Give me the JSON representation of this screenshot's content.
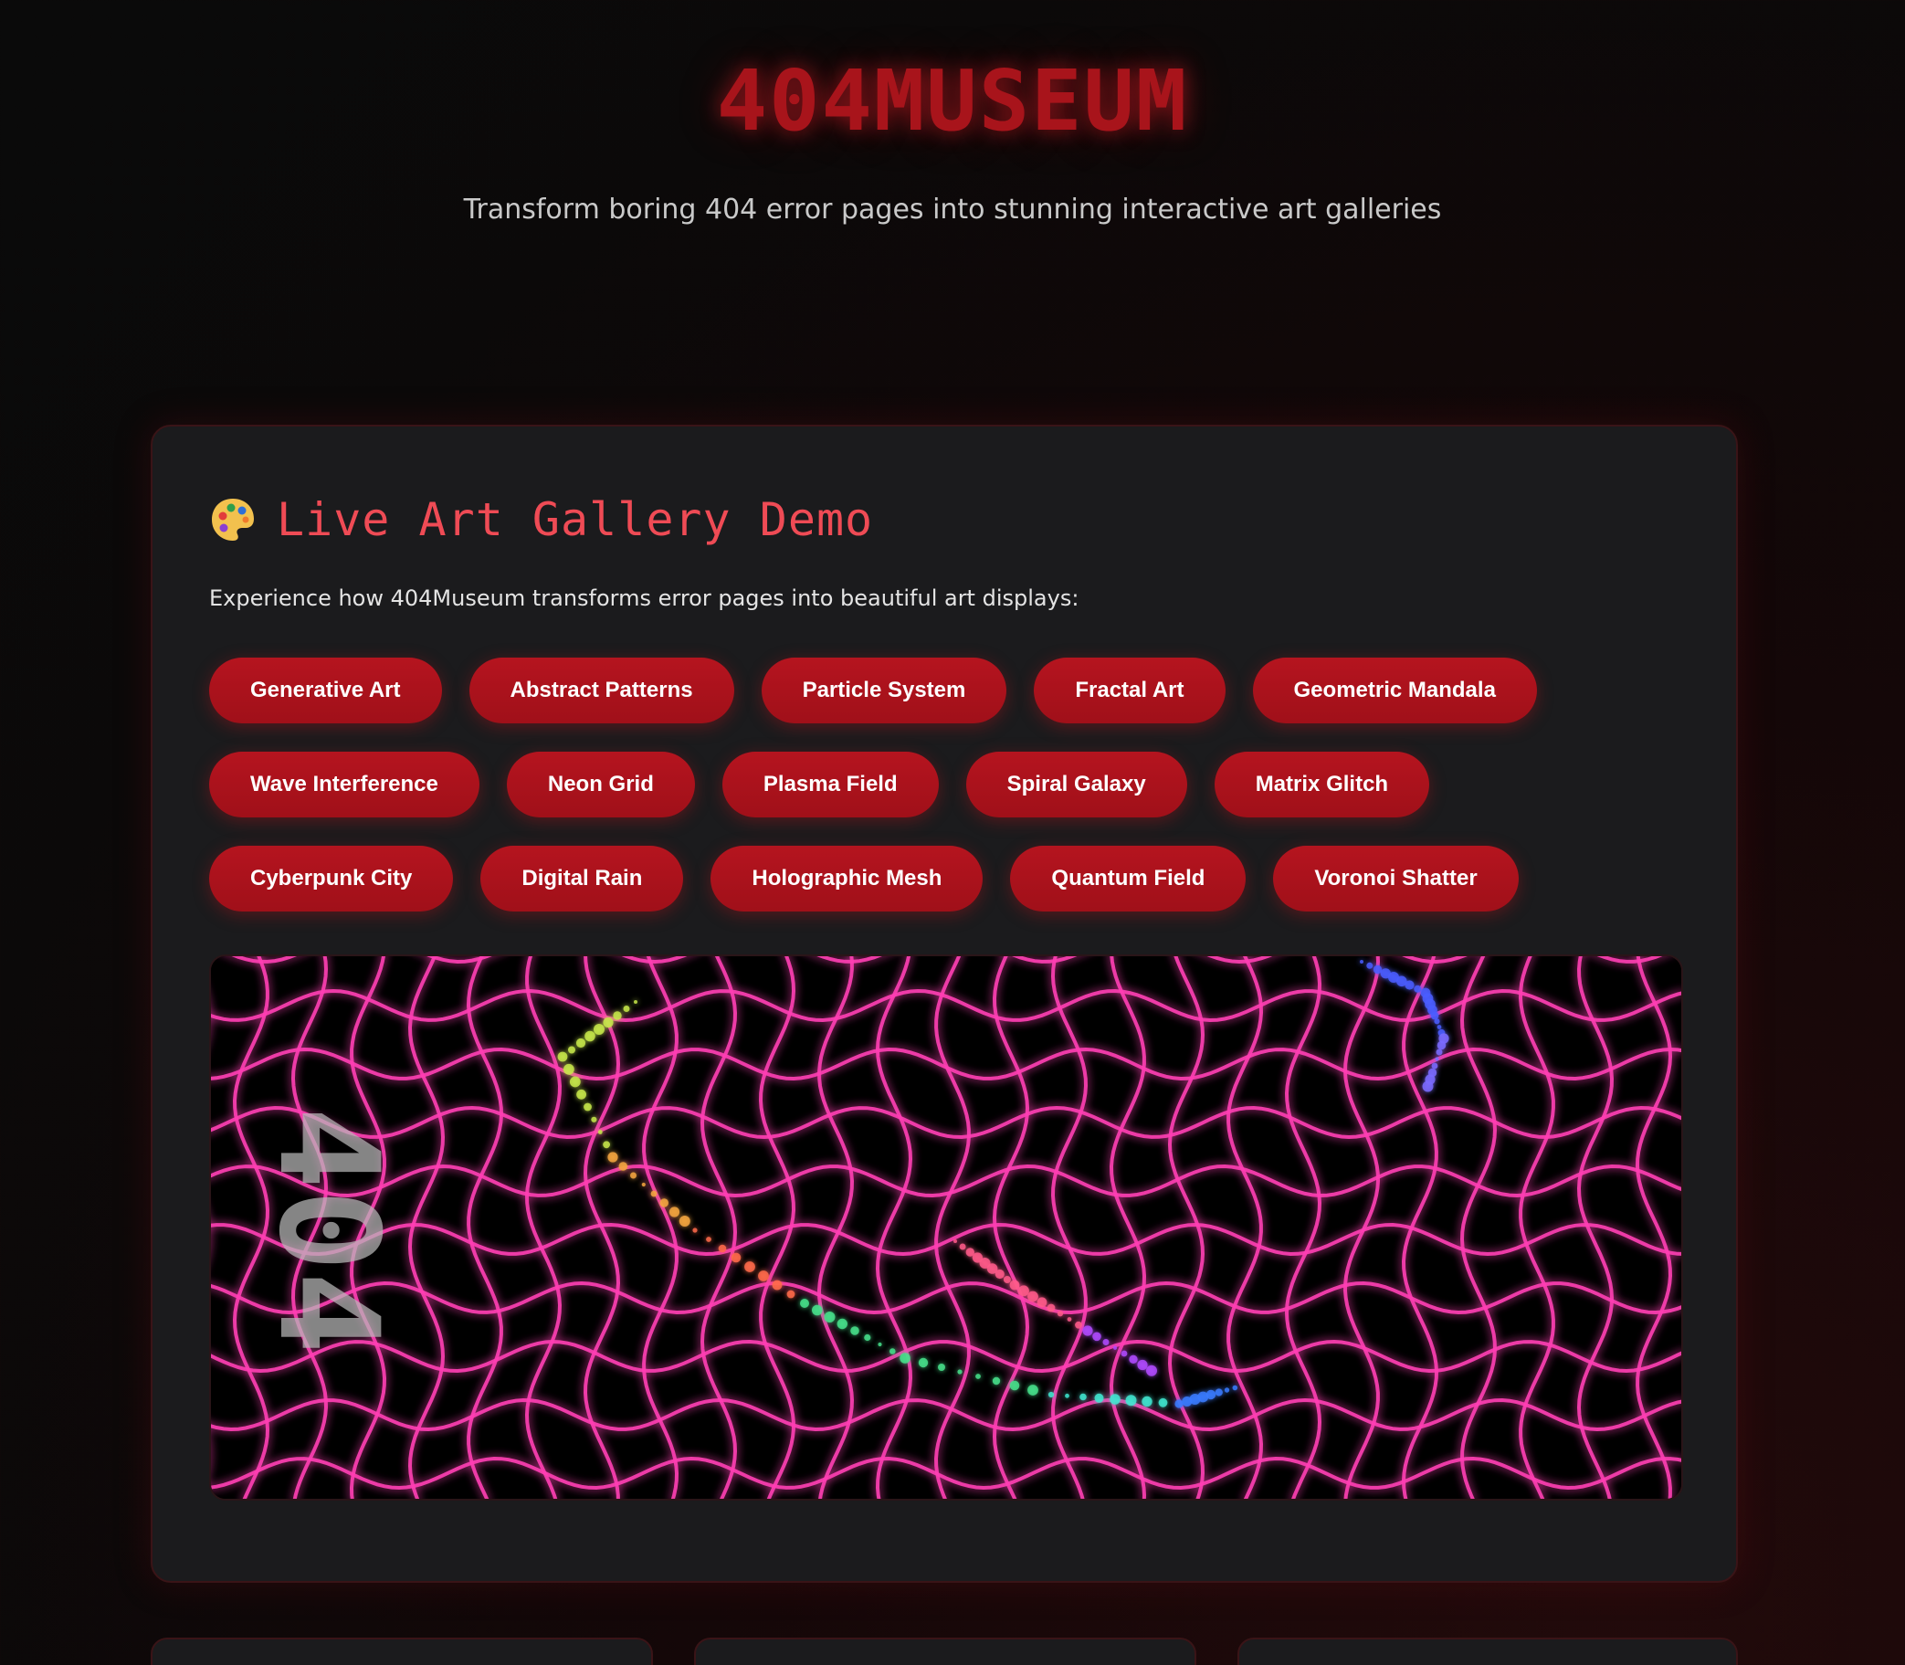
{
  "header": {
    "logo": "404MUSEUM",
    "tagline": "Transform boring 404 error pages into stunning interactive art galleries"
  },
  "demo": {
    "icon": "palette-icon",
    "title": "Live Art Gallery Demo",
    "description": "Experience how 404Museum transforms error pages into beautiful art displays:",
    "styles": [
      "Generative Art",
      "Abstract Patterns",
      "Particle System",
      "Fractal Art",
      "Geometric Mandala",
      "Wave Interference",
      "Neon Grid",
      "Plasma Field",
      "Spiral Galaxy",
      "Matrix Glitch",
      "Cyberpunk City",
      "Digital Rain",
      "Holographic Mesh",
      "Quantum Field",
      "Voronoi Shatter"
    ],
    "canvas_label": "404"
  },
  "colors": {
    "accent": "#ef4b55",
    "button": "#a8121b",
    "grid": "#ff3fb4",
    "panel": "#1b1b1d"
  }
}
